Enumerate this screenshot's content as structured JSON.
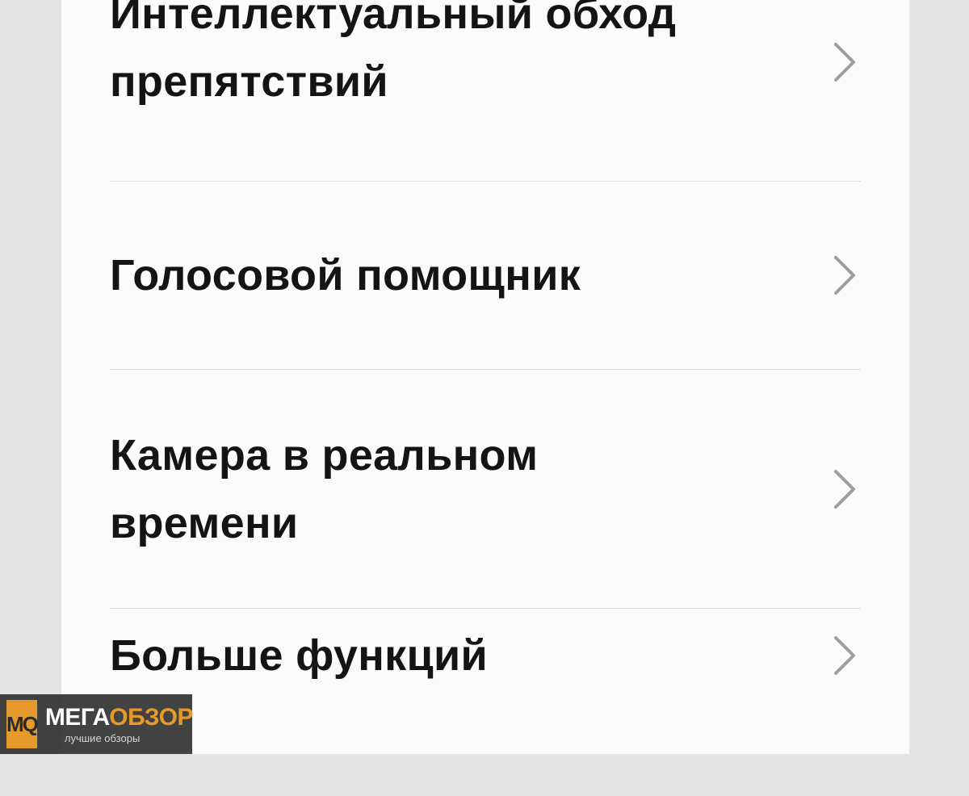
{
  "menu": {
    "items": [
      {
        "label": "Интеллектуальный обход препятствий",
        "icon": "chevron-right-icon"
      },
      {
        "label": "Голосовой помощник",
        "icon": "chevron-right-icon"
      },
      {
        "label": "Камера в реальном времени",
        "icon": "chevron-right-icon"
      },
      {
        "label": "Больше функций",
        "icon": "chevron-right-icon"
      }
    ]
  },
  "watermark": {
    "logo_text": "MQ",
    "title_part1": "МЕГА",
    "title_part2": "ОБЗОР",
    "subtitle": "лучшие обзоры"
  },
  "colors": {
    "background": "#e4e4e4",
    "panel": "#fbfbfb",
    "text": "#141414",
    "divider": "#dedede",
    "chevron": "#9e9e9e",
    "watermark_accent": "#e79a2c"
  }
}
